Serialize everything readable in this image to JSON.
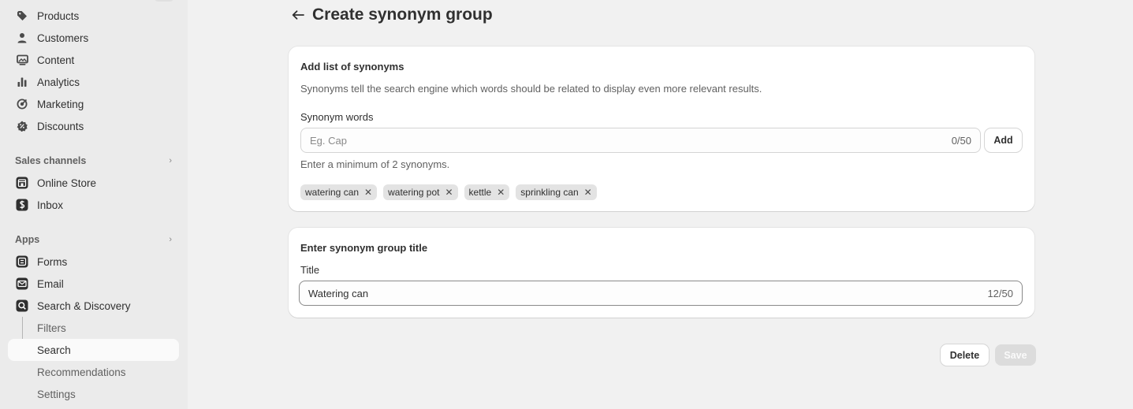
{
  "sidebar": {
    "items": [
      {
        "label": "Products",
        "icon": "tag-icon"
      },
      {
        "label": "Customers",
        "icon": "person-icon"
      },
      {
        "label": "Content",
        "icon": "image-icon"
      },
      {
        "label": "Analytics",
        "icon": "bar-chart-icon"
      },
      {
        "label": "Marketing",
        "icon": "target-icon"
      },
      {
        "label": "Discounts",
        "icon": "discount-icon"
      }
    ],
    "sales_channels": {
      "heading": "Sales channels",
      "items": [
        {
          "label": "Online Store",
          "icon": "store-icon"
        },
        {
          "label": "Inbox",
          "icon": "inbox-app-icon"
        }
      ]
    },
    "apps": {
      "heading": "Apps",
      "items": [
        {
          "label": "Forms",
          "icon": "forms-app-icon"
        },
        {
          "label": "Email",
          "icon": "email-app-icon"
        },
        {
          "label": "Search & Discovery",
          "icon": "search-app-icon"
        }
      ],
      "sub_items": [
        {
          "label": "Filters"
        },
        {
          "label": "Search",
          "active": true
        },
        {
          "label": "Recommendations"
        },
        {
          "label": "Settings"
        }
      ]
    }
  },
  "page": {
    "title": "Create synonym group"
  },
  "synonyms_card": {
    "title": "Add list of synonyms",
    "description": "Synonyms tell the search engine which words should be related to display even more relevant results.",
    "field_label": "Synonym words",
    "placeholder": "Eg. Cap",
    "counter": "0/50",
    "add_label": "Add",
    "help_text": "Enter a minimum of 2 synonyms.",
    "tags": [
      "watering can",
      "watering pot",
      "kettle",
      "sprinkling can"
    ]
  },
  "title_card": {
    "title": "Enter synonym group title",
    "field_label": "Title",
    "value": "Watering can",
    "counter": "12/50"
  },
  "footer": {
    "delete_label": "Delete",
    "save_label": "Save"
  }
}
